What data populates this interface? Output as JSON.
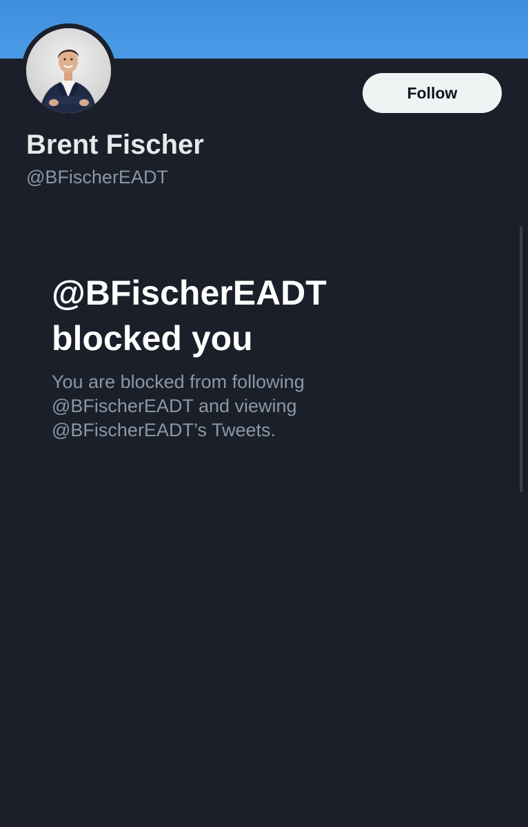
{
  "profile": {
    "display_name": "Brent Fischer",
    "handle": "@BFischerEADT",
    "avatar_alt": "Brent Fischer",
    "follow_label": "Follow"
  },
  "blocked": {
    "title": "@BFischerEADT blocked you",
    "description": "You are blocked from following @BFischerEADT and viewing @BFischerEADT’s Tweets."
  },
  "colors": {
    "banner": "#4a9ae6",
    "background": "#1a1f29",
    "follow_button_bg": "#eff3f4",
    "secondary_text": "#8b98a5"
  }
}
